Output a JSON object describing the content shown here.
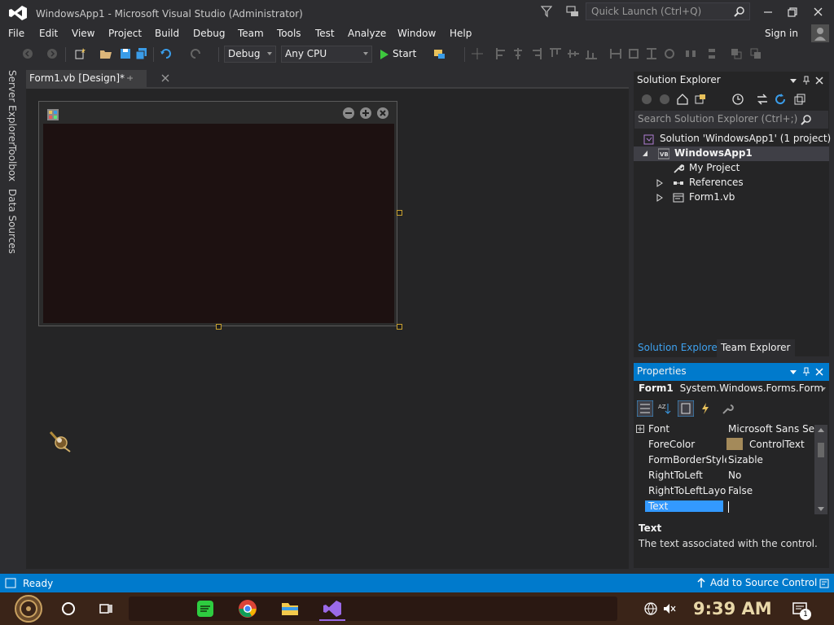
{
  "window": {
    "title": "WindowsApp1 - Microsoft Visual Studio  (Administrator)",
    "quick_launch_placeholder": "Quick Launch (Ctrl+Q)"
  },
  "menu": {
    "items": [
      "File",
      "Edit",
      "View",
      "Project",
      "Build",
      "Debug",
      "Team",
      "Tools",
      "Test",
      "Analyze",
      "Window",
      "Help"
    ],
    "sign_in": "Sign in"
  },
  "toolbar": {
    "configuration": "Debug",
    "platform": "Any CPU",
    "start_label": "Start"
  },
  "left_tabs": [
    "Server Explorer",
    "Toolbox",
    "Data Sources"
  ],
  "document": {
    "tab_label": "Form1.vb [Design]*"
  },
  "solution_explorer": {
    "title": "Solution Explorer",
    "search_placeholder": "Search Solution Explorer (Ctrl+;)",
    "tree": [
      {
        "label": "Solution 'WindowsApp1' (1 project)",
        "icon": "solution-icon"
      },
      {
        "label": "WindowsApp1",
        "icon": "vb-project-icon",
        "selected": true
      },
      {
        "label": "My Project",
        "icon": "wrench-icon"
      },
      {
        "label": "References",
        "icon": "references-icon"
      },
      {
        "label": "Form1.vb",
        "icon": "form-file-icon"
      }
    ],
    "tabs": [
      "Solution Explorer",
      "Team Explorer"
    ]
  },
  "properties": {
    "title": "Properties",
    "object_name": "Form1",
    "object_type": "System.Windows.Forms.Form",
    "rows": [
      {
        "name": "Font",
        "value": "Microsoft Sans Se"
      },
      {
        "name": "ForeColor",
        "value": "ControlText"
      },
      {
        "name": "FormBorderStyle",
        "value": "Sizable"
      },
      {
        "name": "RightToLeft",
        "value": "No"
      },
      {
        "name": "RightToLeftLayout",
        "value": "False"
      },
      {
        "name": "Text",
        "value": ""
      }
    ],
    "description_title": "Text",
    "description_text": "The text associated with the control.",
    "forecolor_swatch": "#a48a5a"
  },
  "status": {
    "text": "Ready",
    "source_control": "Add to Source Control"
  },
  "taskbar": {
    "clock": "9:39 AM",
    "notification_count": "1"
  },
  "colors": {
    "accent": "#007acc",
    "background": "#2d2d30",
    "panel": "#252526"
  }
}
